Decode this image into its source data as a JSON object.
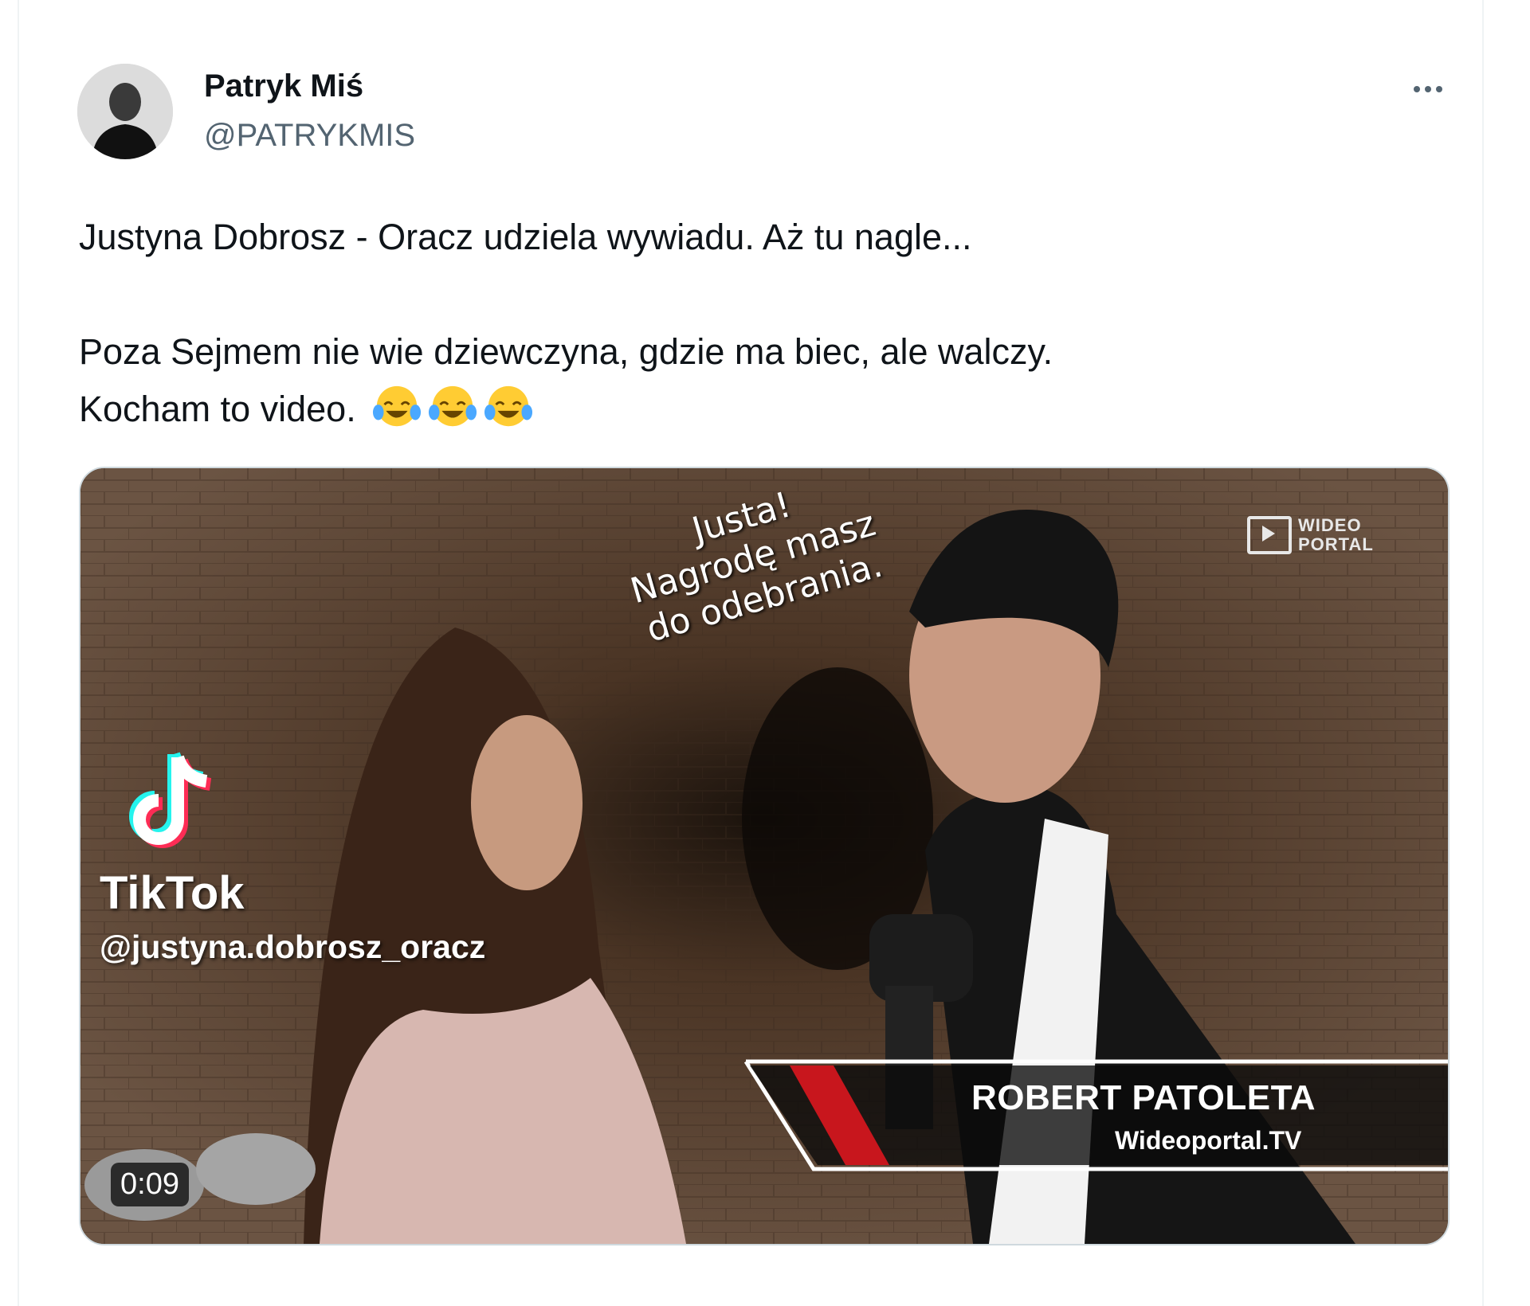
{
  "author": {
    "display_name": "Patryk Miś",
    "handle": "@PATRYKMIS"
  },
  "tweet": {
    "line1": "Justyna Dobrosz - Oracz udziela wywiadu. Aż tu nagle...",
    "line2": "Poza Sejmem nie wie dziewczyna, gdzie ma biec, ale walczy.",
    "line3": "Kocham to video.",
    "emoji": "face-with-tears-of-joy-icon"
  },
  "video": {
    "duration": "0:09",
    "tiktok_brand": "TikTok",
    "tiktok_user": "@justyna.dobrosz_oracz",
    "caption_lines": [
      "Justa!",
      "Nagrodę masz",
      "do odebrania."
    ],
    "channel_logo_line1": "WIDEO",
    "channel_logo_line2": "PORTAL",
    "lower_third_name": "ROBERT PATOLETA",
    "lower_third_site": "Wideoportal.TV"
  },
  "colors": {
    "text": "#0f1419",
    "secondary": "#536471",
    "border": "#cfd9de",
    "lower_third_accent": "#c8161d"
  }
}
